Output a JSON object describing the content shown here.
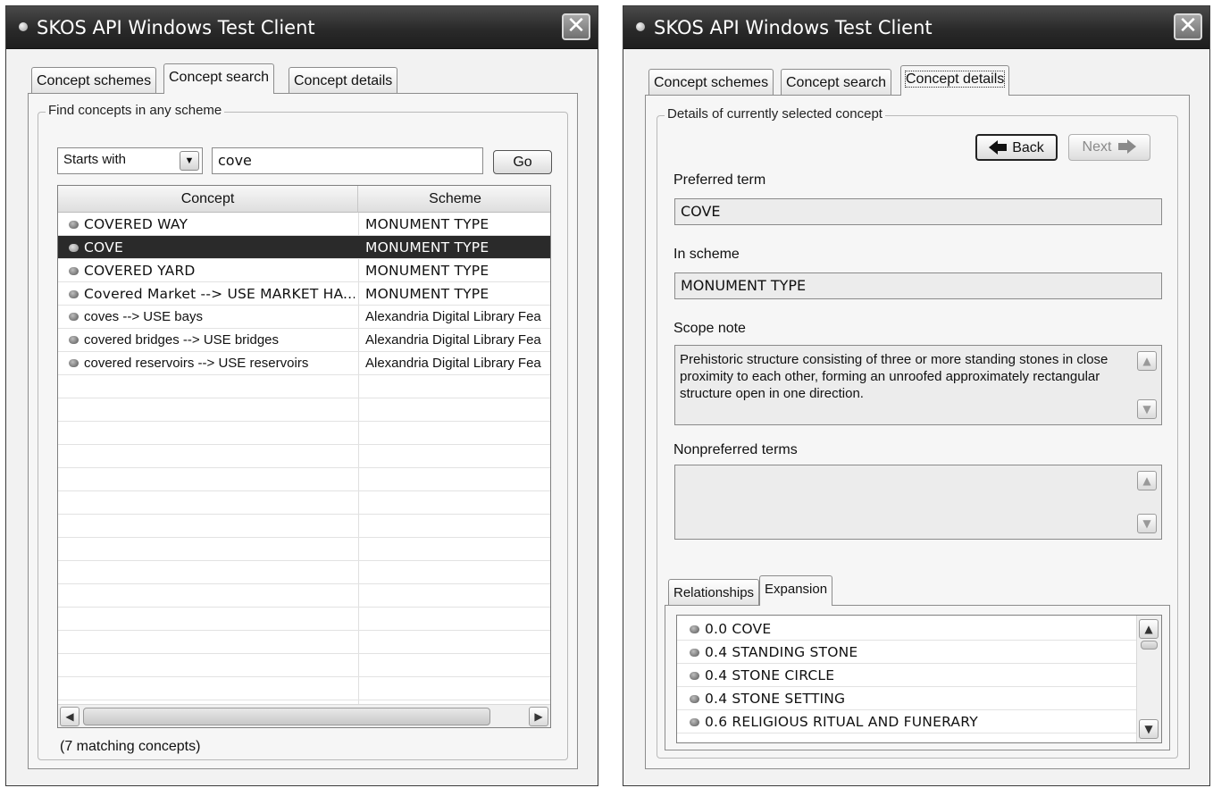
{
  "left_window": {
    "title": "SKOS API Windows Test Client",
    "tabs": [
      "Concept schemes",
      "Concept search",
      "Concept details"
    ],
    "group_label": "Find concepts in any scheme",
    "search_mode": "Starts with",
    "search_text": "cove",
    "go_label": "Go",
    "columns": [
      "Concept",
      "Scheme"
    ],
    "rows": [
      {
        "concept": "COVERED WAY",
        "scheme": "MONUMENT TYPE",
        "selected": false
      },
      {
        "concept": "COVE",
        "scheme": "MONUMENT TYPE",
        "selected": true
      },
      {
        "concept": "COVERED YARD",
        "scheme": "MONUMENT TYPE",
        "selected": false
      },
      {
        "concept": "Covered Market --> USE MARKET HA...",
        "scheme": "MONUMENT TYPE",
        "selected": false
      },
      {
        "concept": "coves --> USE bays",
        "scheme": "Alexandria Digital Library Fea",
        "selected": false
      },
      {
        "concept": "covered bridges --> USE bridges",
        "scheme": "Alexandria Digital Library Fea",
        "selected": false
      },
      {
        "concept": "covered reservoirs --> USE reservoirs",
        "scheme": "Alexandria Digital Library Fea",
        "selected": false
      }
    ],
    "status": "(7 matching concepts)",
    "icons": {
      "close": "close-icon",
      "dropdown": "chevron-down-icon",
      "bullet": "bullet-icon"
    }
  },
  "right_window": {
    "title": "SKOS API Windows Test Client",
    "tabs": [
      "Concept schemes",
      "Concept search",
      "Concept details"
    ],
    "group_label": "Details of currently selected concept",
    "back_label": "Back",
    "next_label": "Next",
    "preferred_term_label": "Preferred term",
    "preferred_term": "COVE",
    "in_scheme_label": "In scheme",
    "in_scheme": "MONUMENT TYPE",
    "scope_note_label": "Scope note",
    "scope_note": "Prehistoric structure consisting of three or more standing stones in close proximity to each other, forming an unroofed approximately rectangular structure open in one direction.",
    "nonpreferred_label": "Nonpreferred terms",
    "nonpreferred": "",
    "sub_tabs": [
      "Relationships",
      "Expansion"
    ],
    "expansion_items": [
      "0.0 COVE",
      "0.4 STANDING STONE",
      "0.4 STONE CIRCLE",
      "0.4 STONE SETTING",
      "0.6 RELIGIOUS RITUAL AND FUNERARY"
    ]
  }
}
